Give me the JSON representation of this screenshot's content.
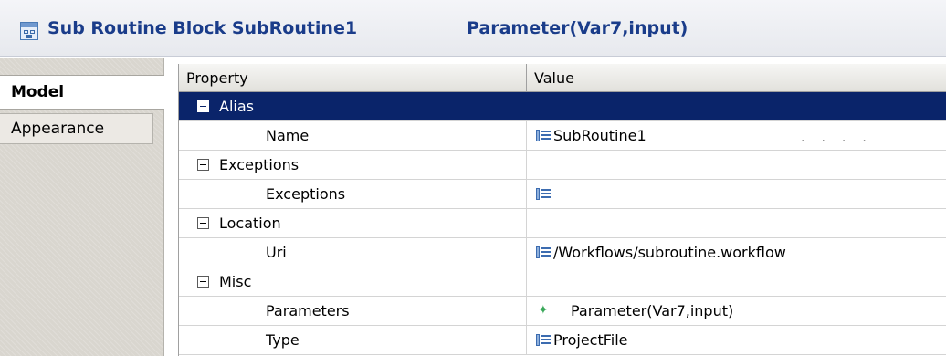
{
  "header": {
    "title": "Sub Routine Block SubRoutine1",
    "parameter": "Parameter(Var7,input)"
  },
  "tabs": [
    {
      "label": "Model",
      "selected": true
    },
    {
      "label": "Appearance",
      "selected": false
    }
  ],
  "grid": {
    "columns": [
      "Property",
      "Value"
    ],
    "rows": [
      {
        "type": "category",
        "label": "Alias",
        "selected": true
      },
      {
        "type": "property",
        "label": "Name",
        "value": "SubRoutine1",
        "icon": "list-icon"
      },
      {
        "type": "category",
        "label": "Exceptions"
      },
      {
        "type": "property",
        "label": "Exceptions",
        "value": "",
        "icon": "list-icon"
      },
      {
        "type": "category",
        "label": "Location"
      },
      {
        "type": "property",
        "label": "Uri",
        "value": "/Workflows/subroutine.workflow",
        "icon": "list-icon"
      },
      {
        "type": "category",
        "label": "Misc"
      },
      {
        "type": "property",
        "label": "Parameters",
        "value": "Parameter(Var7,input)",
        "icon": "parameter-icon"
      },
      {
        "type": "property",
        "label": "Type",
        "value": "ProjectFile",
        "icon": "list-icon"
      }
    ]
  },
  "colors": {
    "selection": "#0a246a",
    "header_text": "#1a3c8a"
  }
}
